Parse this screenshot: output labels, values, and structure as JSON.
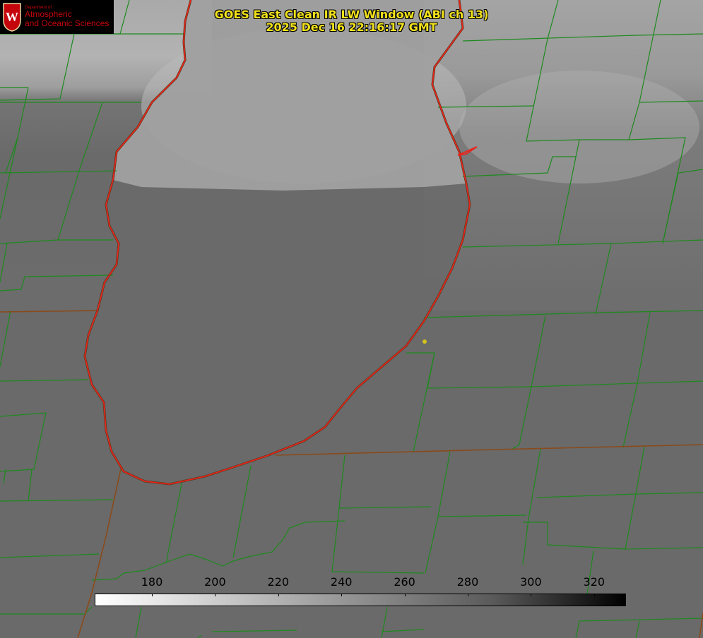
{
  "title": {
    "line1": "GOES East Clean IR LW Window (ABI ch 13)",
    "line2": "2025 Dec 16 22:16:17 GMT"
  },
  "logo": {
    "department_label": "Department of",
    "line1": "Atmospheric",
    "line2": "and Oceanic Sciences",
    "crest_letter": "W",
    "color": "#c5050c"
  },
  "colorbar": {
    "ticks": [
      "180",
      "200",
      "220",
      "240",
      "260",
      "280",
      "300",
      "320"
    ],
    "min_color": "#ffffff",
    "max_color": "#000000"
  },
  "colors": {
    "lake_outline": "#e8241c",
    "county_lines": "#1e8a1e",
    "state_lines": "#8a4a1a",
    "title_text": "#f2e21c",
    "marker": "#d4c21e"
  },
  "icons": {
    "crest": "uw-crest-icon",
    "marker": "location-dot-icon"
  }
}
